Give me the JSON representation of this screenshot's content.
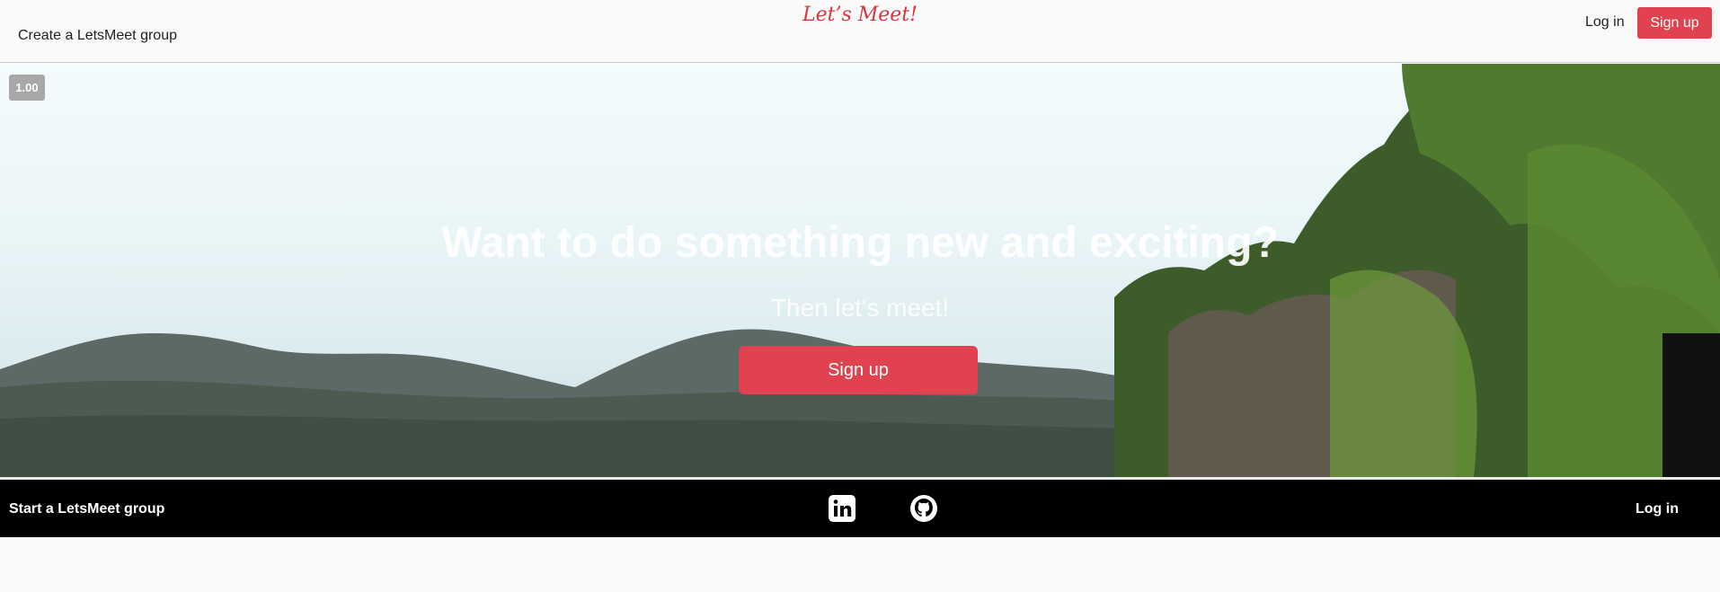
{
  "header": {
    "create_group_label": "Create a LetsMeet group",
    "logo_text": "Let’s Meet!",
    "login_label": "Log in",
    "signup_label": "Sign up"
  },
  "hero": {
    "speed_badge": "1.00",
    "title": "Want to do something new and exciting?",
    "subtitle": "Then let's meet!",
    "signup_label": "Sign up"
  },
  "footer": {
    "start_group_label": "Start a LetsMeet group",
    "login_label": "Log in",
    "icons": [
      "linkedin-icon",
      "github-icon"
    ]
  },
  "colors": {
    "accent": "#e0434f",
    "logo": "#d9343f",
    "footer_bg": "#000000",
    "header_bg": "#fafafa"
  }
}
